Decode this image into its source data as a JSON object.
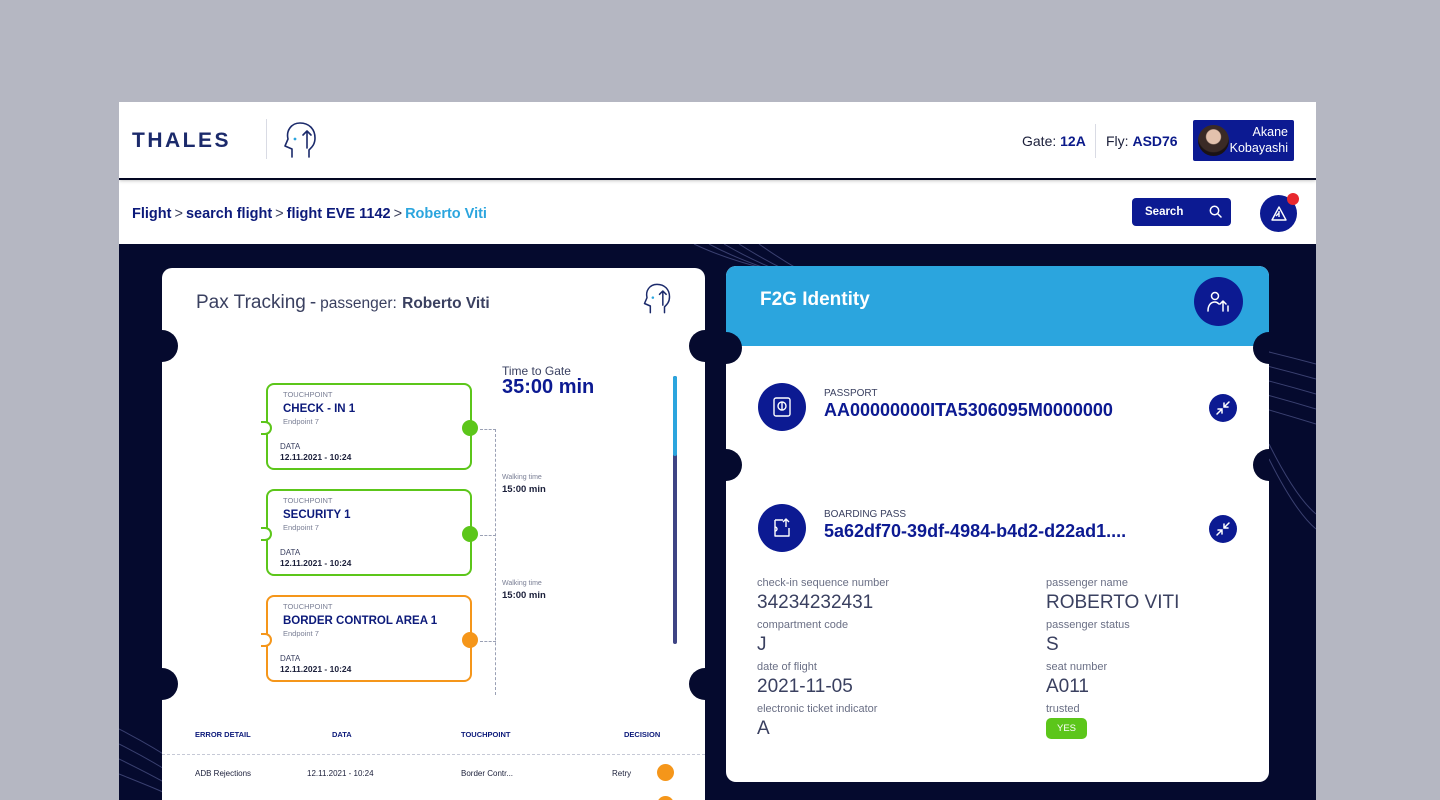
{
  "header": {
    "logo": "THALES",
    "gate_label": "Gate:",
    "gate_value": "12A",
    "fly_label": "Fly:",
    "fly_value": "ASD76",
    "user_first": "Akane",
    "user_last": "Kobayashi"
  },
  "breadcrumb": {
    "items": [
      "Flight",
      "search flight",
      "flight EVE 1142"
    ],
    "separator": ">",
    "current": "Roberto Viti"
  },
  "search": {
    "label": "Search"
  },
  "pax": {
    "title": "Pax Tracking",
    "dash": "-",
    "passenger_label": "passenger:",
    "passenger_name": "Roberto Viti",
    "time_to_gate_label": "Time to Gate",
    "time_to_gate_value": "35:00 min",
    "progress_fraction": 0.3,
    "touchpoints": [
      {
        "kicker": "TOUCHPOINT",
        "name": "CHECK - IN 1",
        "endpoint": "Endpoint 7",
        "data_label": "DATA",
        "date": "12.11.2021 - 10:24",
        "status": "green"
      },
      {
        "kicker": "TOUCHPOINT",
        "name": "SECURITY 1",
        "endpoint": "Endpoint 7",
        "data_label": "DATA",
        "date": "12.11.2021 - 10:24",
        "status": "green"
      },
      {
        "kicker": "TOUCHPOINT",
        "name": "BORDER CONTROL AREA 1",
        "endpoint": "Endpoint 7",
        "data_label": "DATA",
        "date": "12.11.2021 - 10:24",
        "status": "orange"
      }
    ],
    "walking": [
      {
        "label": "Walking time",
        "value": "15:00 min"
      },
      {
        "label": "Walking time",
        "value": "15:00 min"
      }
    ],
    "table": {
      "headers": [
        "ERROR DETAIL",
        "DATA",
        "TOUCHPOINT",
        "DECISION"
      ],
      "rows": [
        {
          "detail": "ADB Rejections",
          "data": "12.11.2021 - 10:24",
          "touchpoint": "Border Contr...",
          "decision": "Retry"
        }
      ]
    }
  },
  "f2g": {
    "title": "F2G Identity",
    "passport_label": "PASSPORT",
    "passport_value": "AA00000000ITA5306095M0000000",
    "boarding_label": "BOARDING PASS",
    "boarding_value": "5a62df70-39df-4984-b4d2-d22ad1....",
    "fields": [
      {
        "label": "check-in sequence number",
        "value": "34234232431"
      },
      {
        "label": "passenger name",
        "value": "ROBERTO VITI"
      },
      {
        "label": "compartment code",
        "value": "J"
      },
      {
        "label": "passenger status",
        "value": "S"
      },
      {
        "label": "date of flight",
        "value": "2021-11-05"
      },
      {
        "label": "seat number",
        "value": "A011"
      },
      {
        "label": "electronic ticket indicator",
        "value": "A"
      },
      {
        "label": "trusted",
        "value": ""
      }
    ],
    "trusted_badge": "YES"
  },
  "colors": {
    "primary": "#0c1a92",
    "accent": "#2ba5de",
    "success": "#5cc61a",
    "warning": "#f5961a",
    "alert": "#e8282e",
    "background": "#050a2e"
  },
  "icons": {
    "search": "search-icon",
    "notification": "notification-icon",
    "face_id": "face-id-icon",
    "passport": "passport-icon",
    "boarding_pass": "boarding-pass-icon",
    "shrink": "shrink-icon",
    "identity": "identity-icon"
  }
}
